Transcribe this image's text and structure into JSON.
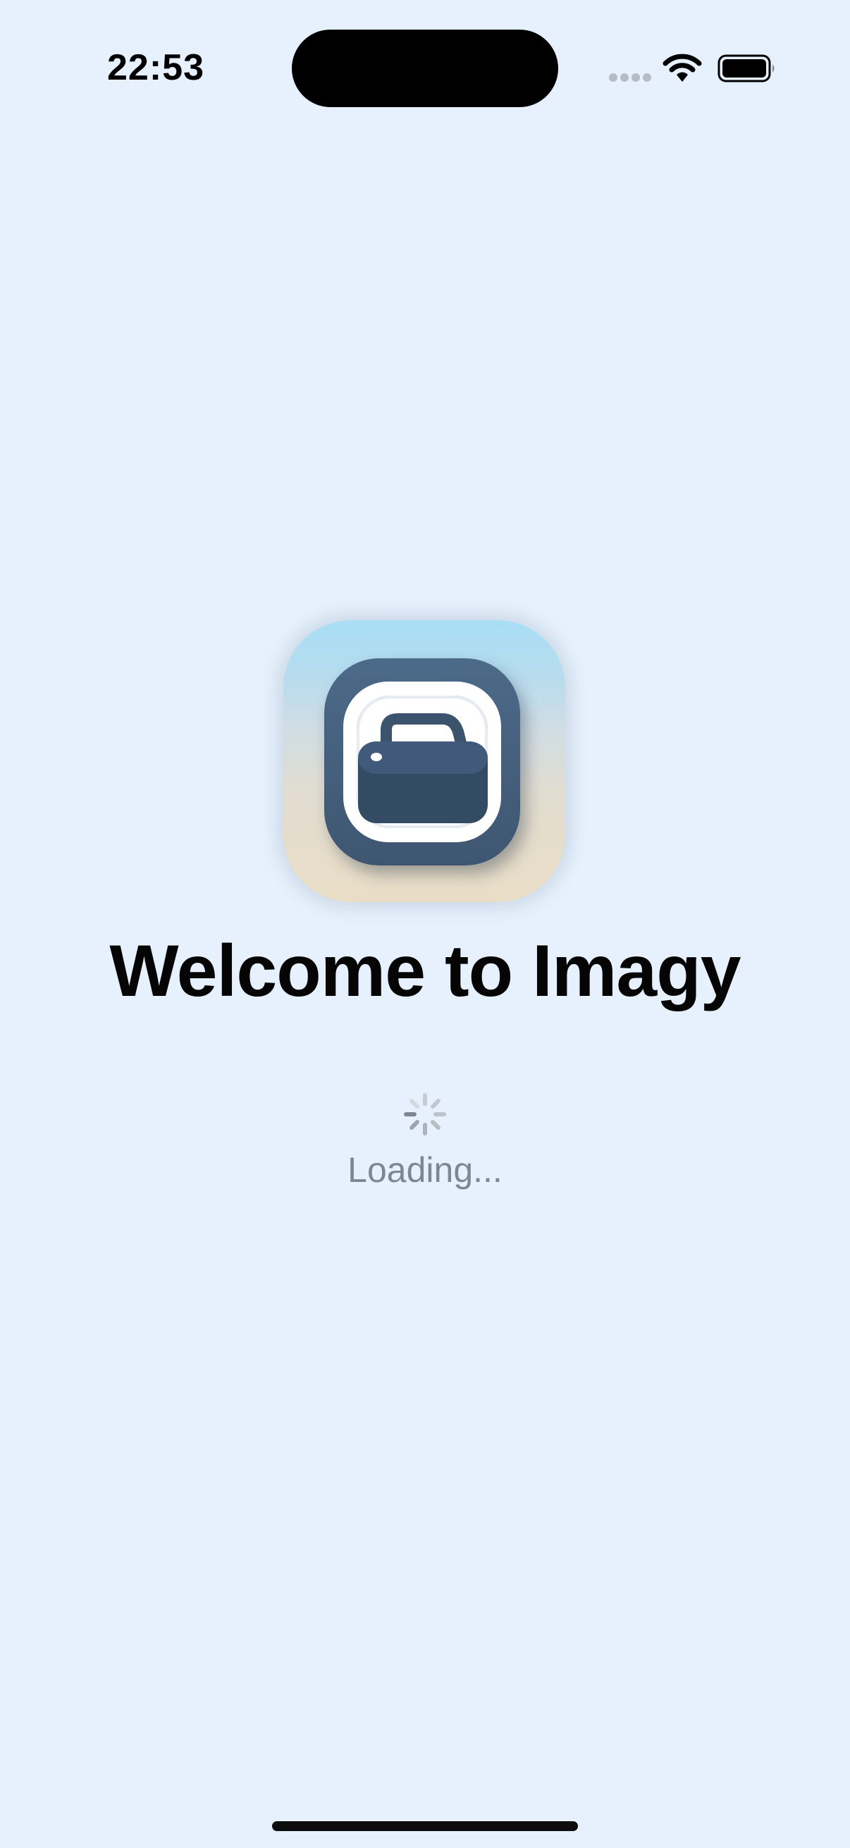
{
  "status_bar": {
    "time": "22:53",
    "icons": [
      "signal-dots-icon",
      "wifi-icon",
      "battery-icon"
    ]
  },
  "splash": {
    "app_icon": "briefcase-app-icon",
    "title": "Welcome to Imagy",
    "loading_text": "Loading...",
    "spinner": "spinner-icon"
  },
  "colors": {
    "background": "#e7f1fe",
    "icon_dark": "#3e5671",
    "title": "#050505",
    "loading_text": "#7c8793"
  }
}
